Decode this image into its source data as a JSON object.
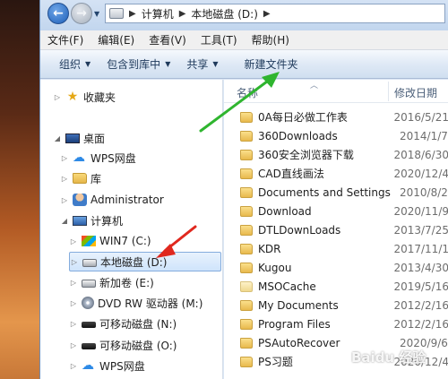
{
  "address_bar": {
    "crumbs": [
      "计算机",
      "本地磁盘 (D:)"
    ]
  },
  "menu": [
    "文件(F)",
    "编辑(E)",
    "查看(V)",
    "工具(T)",
    "帮助(H)"
  ],
  "commands": [
    {
      "label": "组织",
      "dropdown": true
    },
    {
      "label": "包含到库中",
      "dropdown": true
    },
    {
      "label": "共享",
      "dropdown": true
    },
    {
      "label": "新建文件夹",
      "dropdown": false
    }
  ],
  "nav_tree": [
    {
      "label": "收藏夹",
      "icon": "star-icon",
      "expander": "▷"
    },
    {
      "label": "桌面",
      "icon": "desktop-icon",
      "expander": "◢"
    },
    {
      "label": "WPS网盘",
      "icon": "cloud-icon",
      "expander": "▷"
    },
    {
      "label": "库",
      "icon": "library-icon",
      "expander": "▷"
    },
    {
      "label": "Administrator",
      "icon": "user-icon",
      "expander": "▷"
    },
    {
      "label": "计算机",
      "icon": "computer-icon",
      "expander": "◢"
    },
    {
      "label": "WIN7 (C:)",
      "icon": "windows-drive-icon",
      "expander": "▷"
    },
    {
      "label": "本地磁盘 (D:)",
      "icon": "drive-icon",
      "expander": "▷",
      "selected": true
    },
    {
      "label": "新加卷 (E:)",
      "icon": "drive-icon",
      "expander": "▷"
    },
    {
      "label": "DVD RW 驱动器 (M:)",
      "icon": "dvd-icon",
      "expander": "▷"
    },
    {
      "label": "可移动磁盘 (N:)",
      "icon": "usb-drive-icon",
      "expander": "▷"
    },
    {
      "label": "可移动磁盘 (O:)",
      "icon": "usb-drive-icon",
      "expander": "▷"
    },
    {
      "label": "WPS网盘",
      "icon": "cloud-icon",
      "expander": "▷"
    }
  ],
  "file_list": {
    "columns": {
      "name": "名称",
      "date": "修改日期"
    },
    "rows": [
      {
        "name": "0A每日必做工作表",
        "date": "2016/5/21"
      },
      {
        "name": "360Downloads",
        "date": "2014/1/7"
      },
      {
        "name": "360安全浏览器下载",
        "date": "2018/6/30"
      },
      {
        "name": "CAD直线画法",
        "date": "2020/12/4"
      },
      {
        "name": "Documents and Settings",
        "date": "2010/8/2"
      },
      {
        "name": "Download",
        "date": "2020/11/9"
      },
      {
        "name": "DTLDownLoads",
        "date": "2013/7/25"
      },
      {
        "name": "KDR",
        "date": "2017/11/1"
      },
      {
        "name": "Kugou",
        "date": "2013/4/30"
      },
      {
        "name": "MSOCache",
        "date": "2019/5/16"
      },
      {
        "name": "My Documents",
        "date": "2012/2/16"
      },
      {
        "name": "Program Files",
        "date": "2012/2/16"
      },
      {
        "name": "PSAutoRecover",
        "date": "2020/9/6"
      },
      {
        "name": "PS习题",
        "date": "2020/12/4"
      }
    ]
  },
  "watermark": "Baidu 经验",
  "colors": {
    "annotation_green": "#2fb52f",
    "annotation_red": "#e0281e",
    "selection_border": "#84acdd"
  }
}
